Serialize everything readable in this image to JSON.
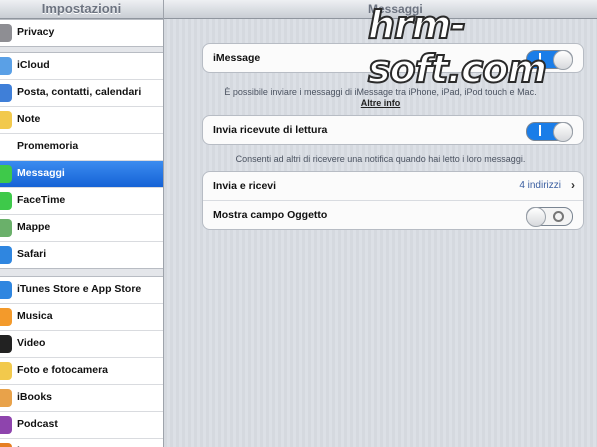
{
  "sidebar": {
    "title": "Impostazioni",
    "groups": [
      [
        {
          "label": "Privacy",
          "icon": "hand-icon",
          "color": "#8e8e93"
        }
      ],
      [
        {
          "label": "iCloud",
          "icon": "cloud-icon",
          "color": "#5aa0e6"
        },
        {
          "label": "Posta, contatti, calendari",
          "icon": "mail-icon",
          "color": "#3f7fd8"
        },
        {
          "label": "Note",
          "icon": "note-icon",
          "color": "#f2c94c"
        },
        {
          "label": "Promemoria",
          "icon": "list-icon",
          "color": "#ffffff"
        },
        {
          "label": "Messaggi",
          "icon": "message-icon",
          "color": "#3ec94a",
          "selected": true
        },
        {
          "label": "FaceTime",
          "icon": "video-icon",
          "color": "#3ec94a"
        },
        {
          "label": "Mappe",
          "icon": "map-icon",
          "color": "#6ab06a"
        },
        {
          "label": "Safari",
          "icon": "compass-icon",
          "color": "#2f86e0"
        }
      ],
      [
        {
          "label": "iTunes Store e App Store",
          "icon": "store-icon",
          "color": "#2f86e0"
        },
        {
          "label": "Musica",
          "icon": "music-icon",
          "color": "#f39a2b"
        },
        {
          "label": "Video",
          "icon": "film-icon",
          "color": "#222222"
        },
        {
          "label": "Foto e fotocamera",
          "icon": "flower-icon",
          "color": "#f2c94c"
        },
        {
          "label": "iBooks",
          "icon": "book-icon",
          "color": "#e8a24a"
        },
        {
          "label": "Podcast",
          "icon": "podcast-icon",
          "color": "#8e44ad"
        },
        {
          "label": "iTunes U",
          "icon": "cap-icon",
          "color": "#e67e22"
        }
      ]
    ]
  },
  "main": {
    "title": "Messaggi",
    "imessage": {
      "label": "iMessage",
      "on": true
    },
    "imessage_note": "È possibile inviare i messaggi di iMessage tra iPhone, iPad, iPod touch e Mac.",
    "more_info": "Altre info",
    "read_receipts": {
      "label": "Invia ricevute di lettura",
      "on": true
    },
    "read_receipts_note": "Consenti ad altri di ricevere una notifica quando hai letto i loro messaggi.",
    "send_receive": {
      "label": "Invia e ricevi",
      "value": "4 indirizzi"
    },
    "subject_field": {
      "label": "Mostra campo Oggetto",
      "on": false
    }
  },
  "watermark": "hrm-soft.com"
}
